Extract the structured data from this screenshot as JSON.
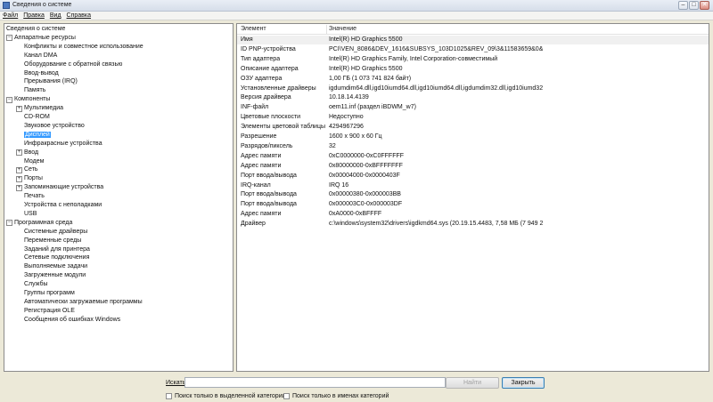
{
  "window": {
    "title": "Сведения о системе",
    "controls": [
      "–",
      "□",
      "✕"
    ]
  },
  "menu": [
    "Файл",
    "Правка",
    "Вид",
    "Справка"
  ],
  "tree": [
    {
      "label": "Сведения о системе",
      "level": 0,
      "toggle": ""
    },
    {
      "label": "Аппаратные ресурсы",
      "level": 0,
      "toggle": "−"
    },
    {
      "label": "Конфликты и совместное использование",
      "level": 1,
      "toggle": ""
    },
    {
      "label": "Канал DMA",
      "level": 1,
      "toggle": ""
    },
    {
      "label": "Оборудование с обратной связью",
      "level": 1,
      "toggle": ""
    },
    {
      "label": "Ввод-вывод",
      "level": 1,
      "toggle": ""
    },
    {
      "label": "Прерывания (IRQ)",
      "level": 1,
      "toggle": ""
    },
    {
      "label": "Память",
      "level": 1,
      "toggle": ""
    },
    {
      "label": "Компоненты",
      "level": 0,
      "toggle": "−"
    },
    {
      "label": "Мультимедиа",
      "level": 1,
      "toggle": "+"
    },
    {
      "label": "CD-ROM",
      "level": 1,
      "toggle": ""
    },
    {
      "label": "Звуковое устройство",
      "level": 1,
      "toggle": ""
    },
    {
      "label": "Дисплей",
      "level": 1,
      "toggle": "",
      "selected": true
    },
    {
      "label": "Инфракрасные устройства",
      "level": 1,
      "toggle": ""
    },
    {
      "label": "Ввод",
      "level": 1,
      "toggle": "+"
    },
    {
      "label": "Модем",
      "level": 1,
      "toggle": ""
    },
    {
      "label": "Сеть",
      "level": 1,
      "toggle": "+"
    },
    {
      "label": "Порты",
      "level": 1,
      "toggle": "+"
    },
    {
      "label": "Запоминающие устройства",
      "level": 1,
      "toggle": "+"
    },
    {
      "label": "Печать",
      "level": 1,
      "toggle": ""
    },
    {
      "label": "Устройства с неполадками",
      "level": 1,
      "toggle": ""
    },
    {
      "label": "USB",
      "level": 1,
      "toggle": ""
    },
    {
      "label": "Программная среда",
      "level": 0,
      "toggle": "−"
    },
    {
      "label": "Системные драйверы",
      "level": 1,
      "toggle": ""
    },
    {
      "label": "Переменные среды",
      "level": 1,
      "toggle": ""
    },
    {
      "label": "Заданий для принтера",
      "level": 1,
      "toggle": ""
    },
    {
      "label": "Сетевые подключения",
      "level": 1,
      "toggle": ""
    },
    {
      "label": "Выполняемые задачи",
      "level": 1,
      "toggle": ""
    },
    {
      "label": "Загруженные модули",
      "level": 1,
      "toggle": ""
    },
    {
      "label": "Службы",
      "level": 1,
      "toggle": ""
    },
    {
      "label": "Группы программ",
      "level": 1,
      "toggle": ""
    },
    {
      "label": "Автоматически загружаемые программы",
      "level": 1,
      "toggle": ""
    },
    {
      "label": "Регистрация OLE",
      "level": 1,
      "toggle": ""
    },
    {
      "label": "Сообщения об ошибках Windows",
      "level": 1,
      "toggle": ""
    }
  ],
  "details": {
    "headers": [
      "Элемент",
      "Значение"
    ],
    "rows": [
      [
        "Имя",
        "Intel(R) HD Graphics 5500"
      ],
      [
        "ID PNP-устройства",
        "PCI\\VEN_8086&DEV_1616&SUBSYS_103D1025&REV_09\\3&11583659&0&10"
      ],
      [
        "Тип адаптера",
        "Intel(R) HD Graphics Family, Intel Corporation-совместимый"
      ],
      [
        "Описание адаптера",
        "Intel(R) HD Graphics 5500"
      ],
      [
        "ОЗУ адаптера",
        "1,00 ГБ (1 073 741 824 байт)"
      ],
      [
        "Установленные драйверы",
        "igdumdim64.dll,igd10iumd64.dll,igd10iumd64.dll,igdumdim32.dll,igd10iumd32.dll,ig..."
      ],
      [
        "Версия драйвера",
        "10.18.14.4139"
      ],
      [
        "INF-файл",
        "oem11.inf (раздел iBDWM_w7)"
      ],
      [
        "Цветовые плоскости",
        "Недоступно"
      ],
      [
        "Элементы цветовой таблицы",
        "4294967296"
      ],
      [
        "Разрешение",
        "1600 x 900 x 60 Гц"
      ],
      [
        "Разрядов/пиксель",
        "32"
      ],
      [
        "Адрес памяти",
        "0xC0000000-0xC0FFFFFF"
      ],
      [
        "Адрес памяти",
        "0x80000000-0xBFFFFFFF"
      ],
      [
        "Порт ввода/вывода",
        "0x00004000-0x0000403F"
      ],
      [
        "IRQ-канал",
        "IRQ 16"
      ],
      [
        "Порт ввода/вывода",
        "0x00000380-0x000003BB"
      ],
      [
        "Порт ввода/вывода",
        "0x000003C0-0x000003DF"
      ],
      [
        "Адрес памяти",
        "0xA0000-0xBFFFF"
      ],
      [
        "Драйвер",
        "c:\\windows\\system32\\drivers\\igdkmd64.sys (20.19.15.4483, 7,58 МБ (7 949 29..."
      ]
    ]
  },
  "search": {
    "label": "Искать:",
    "value": "",
    "find_button": "Найти",
    "close_button": "Закрыть",
    "opt_selected_category": "Поиск только в выделенной категории",
    "opt_category_names": "Поиск только в именах категорий"
  }
}
